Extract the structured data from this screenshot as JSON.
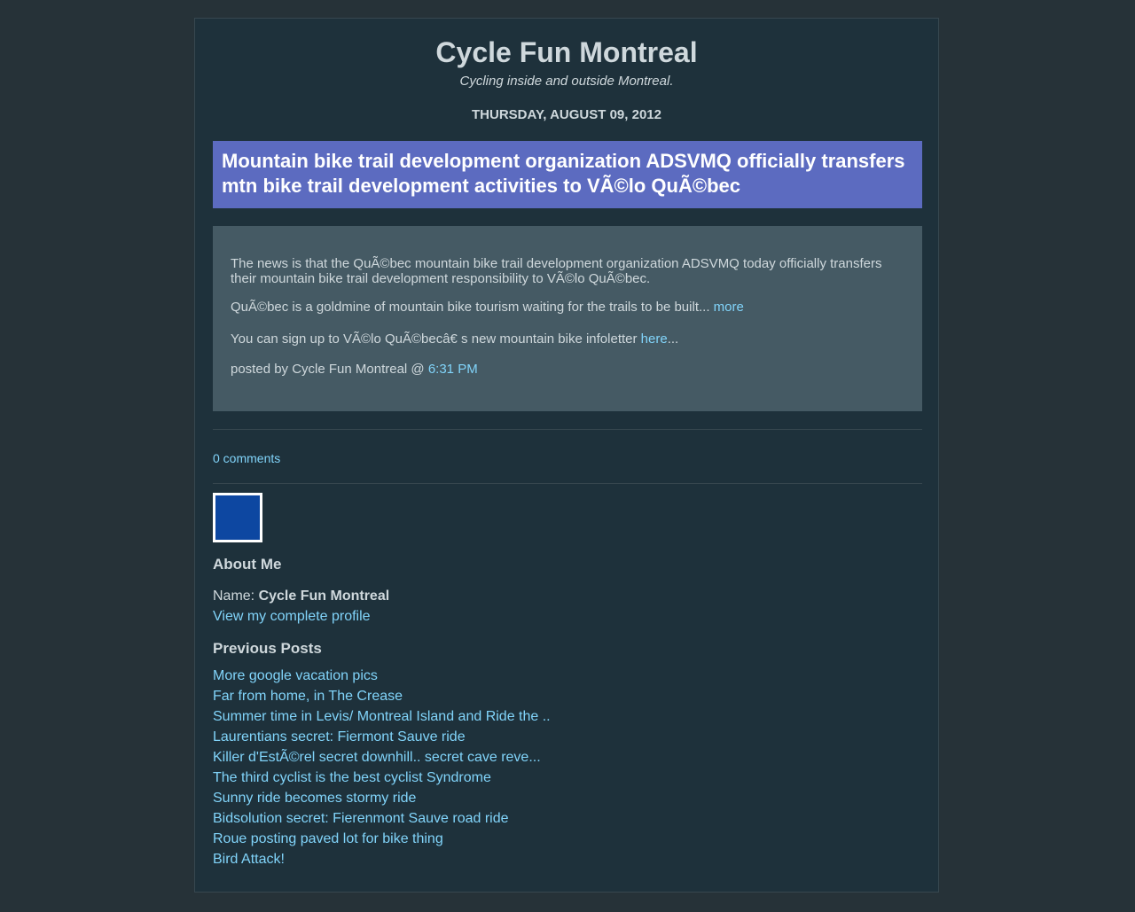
{
  "header": {
    "title": "Cycle Fun Montreal",
    "description": "Cycling inside and outside Montreal."
  },
  "post": {
    "date": "Thursday, August 09, 2012",
    "title": "Mountain bike trail development organization ADSVMQ officially transfers mtn bike trail development activities to VÃ©lo QuÃ©bec",
    "paragraph1": "The news is that the QuÃ©bec mountain bike trail development organization ADSVMQ today officially transfers their mountain bike trail development responsibility to VÃ©lo QuÃ©bec.",
    "paragraph2_text": "QuÃ©bec is a goldmine of mountain bike tourism waiting for the trails to be built... ",
    "paragraph2_link": "more",
    "paragraph3_text": "You can sign up to VÃ©lo QuÃ©becâ€   s new mountain bike infoletter ",
    "paragraph3_link": "here",
    "paragraph3_suffix": "...",
    "posted_by": "posted by Cycle Fun Montreal @ ",
    "time": "6:31 PM",
    "comments": "0 comments"
  },
  "sidebar": {
    "about_heading": "About Me",
    "name_label": "Name: ",
    "name_value": "Cycle Fun Montreal",
    "profile_link": "View my complete profile",
    "previous_heading": "Previous Posts",
    "previous_posts": [
      "More google vacation pics",
      "Far from home, in The Crease",
      "Summer time in Levis/ Montreal Island and Ride the ..",
      "Laurentians secret: Fiermont Sauve ride",
      "Killer d'EstÃ©rel secret downhill.. secret cave reve...",
      "The third cyclist is the best cyclist Syndrome",
      "Sunny ride becomes stormy ride",
      "Bidsolution secret: Fierenmont Sauve road ride",
      "Roue posting paved lot for bike thing",
      "Bird Attack!"
    ]
  },
  "colors": {
    "page_bg": "#263238",
    "container_bg": "#1e313b",
    "title_bar": "#5c6bc0",
    "post_body_bg": "#455a64",
    "link": "#81d4fa",
    "avatar": "#0d47a1"
  }
}
